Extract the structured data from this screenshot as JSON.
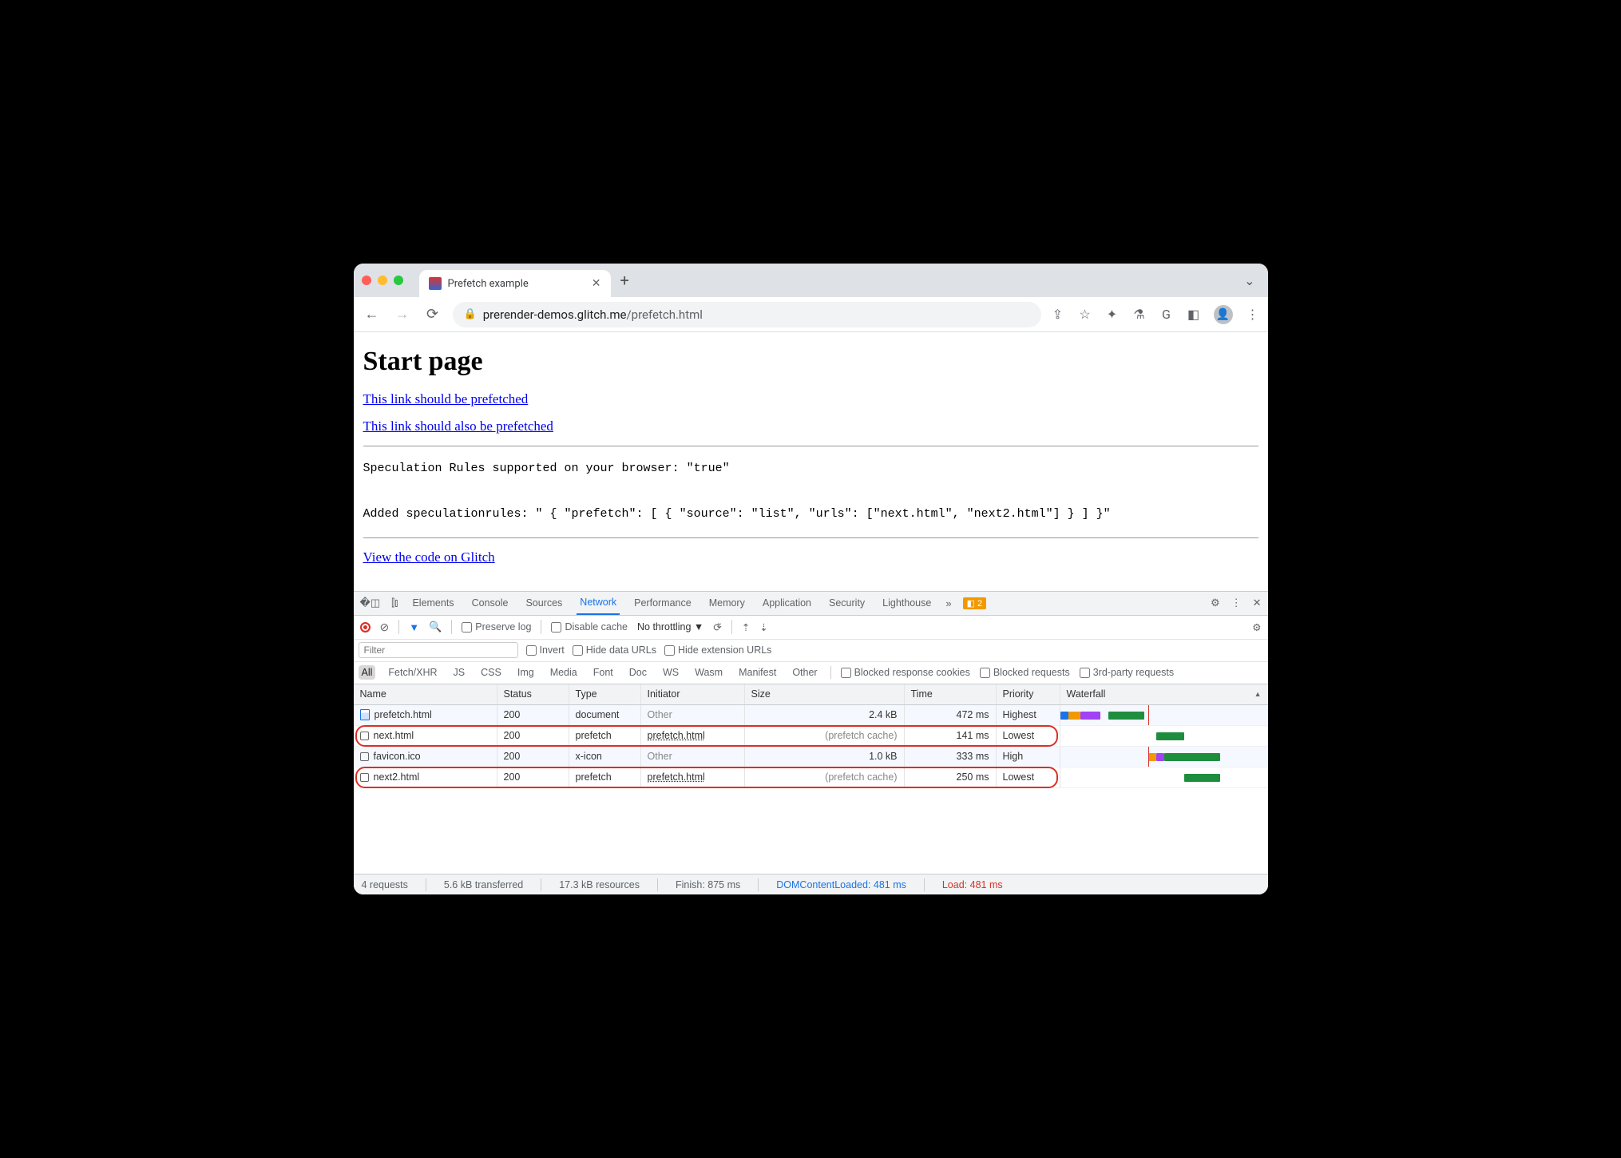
{
  "tab": {
    "title": "Prefetch example"
  },
  "url": {
    "domain": "prerender-demos.glitch.me",
    "path": "/prefetch.html"
  },
  "page": {
    "heading": "Start page",
    "link1": "This link should be prefetched",
    "link2": "This link should also be prefetched",
    "pre_line1": "Speculation Rules supported on your browser: \"true\"",
    "pre_line2": "Added speculationrules: \" { \"prefetch\": [ { \"source\": \"list\", \"urls\": [\"next.html\", \"next2.html\"] } ] }\"",
    "link3": "View the code on Glitch"
  },
  "devtools": {
    "tabs": [
      "Elements",
      "Console",
      "Sources",
      "Network",
      "Performance",
      "Memory",
      "Application",
      "Security",
      "Lighthouse"
    ],
    "active_tab": "Network",
    "warn_count": "2",
    "controls": {
      "preserve_log": "Preserve log",
      "disable_cache": "Disable cache",
      "throttling": "No throttling"
    },
    "filter": {
      "placeholder": "Filter",
      "invert": "Invert",
      "hide_data": "Hide data URLs",
      "hide_ext": "Hide extension URLs"
    },
    "types": [
      "All",
      "Fetch/XHR",
      "JS",
      "CSS",
      "Img",
      "Media",
      "Font",
      "Doc",
      "WS",
      "Wasm",
      "Manifest",
      "Other"
    ],
    "type_checks": {
      "blocked_cookies": "Blocked response cookies",
      "blocked_req": "Blocked requests",
      "third_party": "3rd-party requests"
    },
    "columns": [
      "Name",
      "Status",
      "Type",
      "Initiator",
      "Size",
      "Time",
      "Priority",
      "Waterfall"
    ],
    "rows": [
      {
        "name": "prefetch.html",
        "status": "200",
        "type": "document",
        "initiator": "Other",
        "initiator_link": false,
        "size": "2.4 kB",
        "size_muted": false,
        "time": "472 ms",
        "priority": "Highest",
        "icon": "doc",
        "wf": [
          {
            "l": 0,
            "w": 2,
            "c": "#1a73e8"
          },
          {
            "l": 2,
            "w": 3,
            "c": "#f29900"
          },
          {
            "l": 5,
            "w": 5,
            "c": "#a142f4"
          },
          {
            "l": 12,
            "w": 9,
            "c": "#1e8e3e"
          }
        ]
      },
      {
        "name": "next.html",
        "status": "200",
        "type": "prefetch",
        "initiator": "prefetch.html",
        "initiator_link": true,
        "size": "(prefetch cache)",
        "size_muted": true,
        "time": "141 ms",
        "priority": "Lowest",
        "icon": "file",
        "wf": [
          {
            "l": 24,
            "w": 7,
            "c": "#1e8e3e"
          }
        ]
      },
      {
        "name": "favicon.ico",
        "status": "200",
        "type": "x-icon",
        "initiator": "Other",
        "initiator_link": false,
        "size": "1.0 kB",
        "size_muted": false,
        "time": "333 ms",
        "priority": "High",
        "icon": "file",
        "wf": [
          {
            "l": 22,
            "w": 2,
            "c": "#f29900"
          },
          {
            "l": 24,
            "w": 2,
            "c": "#a142f4"
          },
          {
            "l": 26,
            "w": 14,
            "c": "#1e8e3e"
          }
        ]
      },
      {
        "name": "next2.html",
        "status": "200",
        "type": "prefetch",
        "initiator": "prefetch.html",
        "initiator_link": true,
        "size": "(prefetch cache)",
        "size_muted": true,
        "time": "250 ms",
        "priority": "Lowest",
        "icon": "file",
        "wf": [
          {
            "l": 31,
            "w": 9,
            "c": "#1e8e3e"
          }
        ]
      }
    ],
    "status": {
      "requests": "4 requests",
      "transferred": "5.6 kB transferred",
      "resources": "17.3 kB resources",
      "finish": "Finish: 875 ms",
      "dcl": "DOMContentLoaded: 481 ms",
      "load": "Load: 481 ms"
    }
  }
}
